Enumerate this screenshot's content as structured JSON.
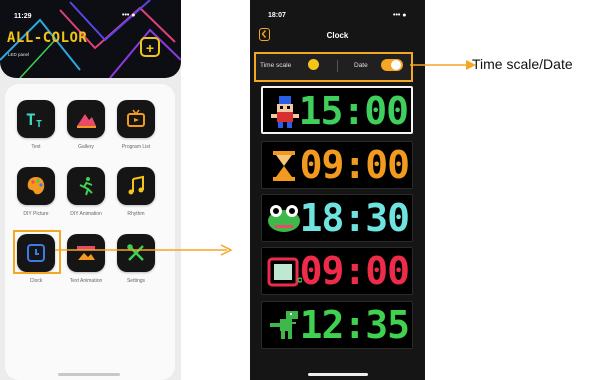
{
  "left_phone": {
    "status_time": "11:29",
    "status_icons": "••• ●",
    "logo": "ALL-COLOR",
    "subtitle": "LED panel",
    "add_label": "+",
    "apps": [
      {
        "label": "Text",
        "icon": "text-icon"
      },
      {
        "label": "Gallery",
        "icon": "gallery-icon"
      },
      {
        "label": "Program List",
        "icon": "tv-icon"
      },
      {
        "label": "DIY Picture",
        "icon": "palette-icon"
      },
      {
        "label": "DIY Animation",
        "icon": "running-figure-icon"
      },
      {
        "label": "Rhythm",
        "icon": "music-note-icon"
      },
      {
        "label": "Clock",
        "icon": "clock-icon"
      },
      {
        "label": "Text Animation",
        "icon": "text-animation-icon"
      },
      {
        "label": "Settings",
        "icon": "settings-icon"
      }
    ],
    "accent": "#f0c419"
  },
  "right_phone": {
    "status_time": "18:07",
    "title": "Clock",
    "options": {
      "time_scale_label": "Time scale",
      "date_label": "Date",
      "date_enabled": true
    },
    "clocks": [
      {
        "time": "15:00",
        "color": "#3ecf5c",
        "icon": "robot-character-icon",
        "selected": true
      },
      {
        "time": "09:00",
        "color": "#f29a1f",
        "icon": "hourglass-icon",
        "selected": false
      },
      {
        "time": "18:30",
        "color": "#6fe3e0",
        "icon": "frog-icon",
        "selected": false
      },
      {
        "time": "09:00",
        "color": "#ee2c4a",
        "icon": "tv-screen-icon",
        "selected": false
      },
      {
        "time": "12:35",
        "color": "#3fd14f",
        "icon": "dinosaur-icon",
        "selected": false
      }
    ],
    "accent": "#f5a623"
  },
  "annotation": {
    "label": "Time scale/Date",
    "color": "#f5a623"
  }
}
